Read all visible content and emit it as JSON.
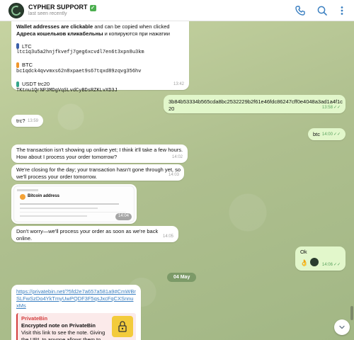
{
  "header": {
    "name": "CYPHER SUPPORT",
    "status": "last seen recently",
    "badge_glyph": "✓",
    "icons": [
      "phone-icon",
      "search-icon",
      "more-vertical-icon"
    ]
  },
  "colors": {
    "accent": "#3a7fc1",
    "outgoing": "#e2f7cb",
    "incoming": "#ffffff",
    "wallpaper": "#b9c99a",
    "date_pill": "#7c9a68"
  },
  "messages": {
    "wallets": {
      "line1_bold": "Wallet addresses are clickable",
      "line1_rest": " and can be copied when clicked",
      "line2_bold": "Адреса кошельков кликабельны",
      "line2_rest": " и копируются при нажатии",
      "coins": [
        {
          "name": "LTC",
          "address": "ltc1q3u5a2hnjfkvefj7geg6xcvdl7en6t3xpn8u3km",
          "icon": "ltc-coin-icon",
          "color": "#3a5fa8"
        },
        {
          "name": "BTC",
          "address": "bc1qdck4qvvmxs62n8xpaet9s67tqxd89zqvg356hv",
          "icon": "btc-coin-icon",
          "color": "#f0962a"
        },
        {
          "name": "USDT trc20",
          "address": "TKtnu1QrNP3MDgVqSLvdCyBDsRZKLvXD3J",
          "icon": "usdt-coin-icon",
          "color": "#33a58a"
        }
      ],
      "time": "13:42"
    },
    "hash": {
      "text": "3b84b53334b565cda8bc2532229b2f61e46fdc86247cff0e4048a3ad1a4f1c20",
      "time": "13:58",
      "ticks": "✓✓"
    },
    "trc": {
      "text": "trc?",
      "time": "13:59"
    },
    "btc": {
      "text": "btc",
      "time": "14:00",
      "ticks": "✓✓"
    },
    "not_showing": {
      "text": "The transaction isn't showing up online yet; I think it'll take a few hours. How about I process your order tomorrow?",
      "time": "14:02"
    },
    "closing": {
      "text": "We're closing for the day; your transaction hasn't gone through yet, so we'll process your order tomorrow.",
      "time": "14:03"
    },
    "screenshot": {
      "title": "Bitcoin address",
      "time": "14:04"
    },
    "dont_worry": {
      "text": "Don't worry—we'll process your order as soon as we're back online.",
      "time": "14:05"
    },
    "ok": {
      "text": "Ok",
      "emoji": "👌",
      "time": "14:06",
      "ticks": "✓✓"
    },
    "date_divider": "04 May",
    "privatebin": {
      "link": "https://privatebin.net/?5fd2e7a657a581a9#CmWBrSLFwSzDo4YkTmyUwPQDF3F5qsJxcFqCXSnnuxMs",
      "site": "PrivateBin",
      "title": "Encrypted note on PrivateBin",
      "desc": "Visit this link to see the note. Giving the URL to anyone allows them to access the note, too."
    }
  }
}
